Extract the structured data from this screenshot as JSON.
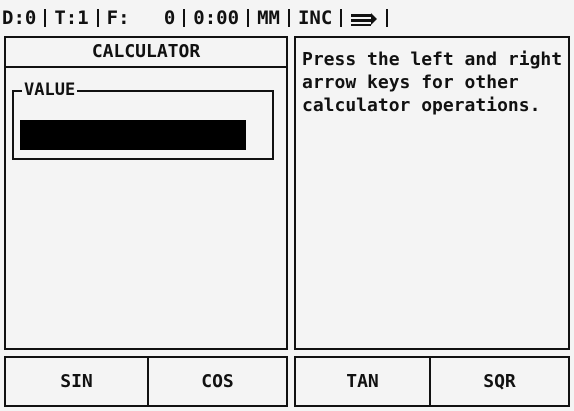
{
  "status_bar": {
    "datum": "D:0",
    "tool": "T:1",
    "feed": "F:   0",
    "time": "0:00",
    "units": "MM",
    "mode": "INC",
    "icon": "tool-indicator-icon"
  },
  "left_panel": {
    "title": "CALCULATOR",
    "value_label": "VALUE",
    "value": ""
  },
  "right_panel": {
    "help_text": "Press the left and right arrow keys for other calculator operations."
  },
  "softkeys": {
    "sin": "SIN",
    "cos": "COS",
    "tan": "TAN",
    "sqr": "SQR"
  }
}
